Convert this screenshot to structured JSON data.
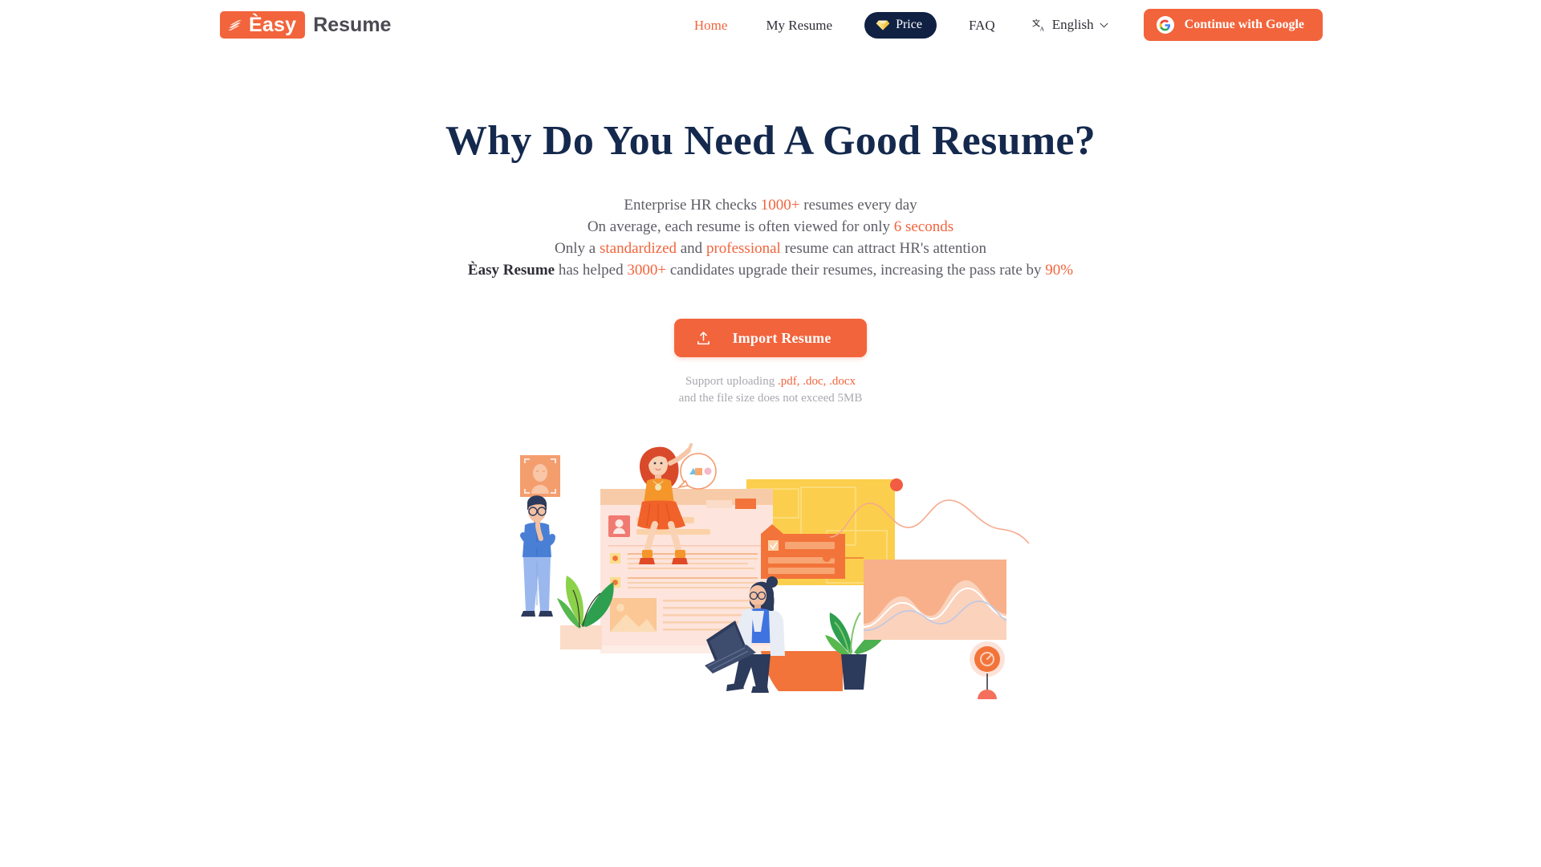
{
  "brand": {
    "mark_icon": "stacked-lines-logo-icon",
    "easy": "Èasy",
    "resume": "Resume"
  },
  "nav": {
    "items": [
      {
        "label": "Home",
        "active": true
      },
      {
        "label": "My Resume",
        "active": false
      }
    ],
    "price": {
      "label": "Price",
      "icon": "gem-icon",
      "bg": "#102144"
    },
    "faq": {
      "label": "FAQ"
    },
    "language": {
      "label": "English",
      "icon": "translate-icon",
      "chevron": "chevron-down-icon"
    },
    "google": {
      "label": "Continue with Google",
      "icon": "google-g-icon",
      "bg": "#F2643C"
    }
  },
  "hero": {
    "title": "Why Do You Need A Good Resume?",
    "line1": {
      "a": "Enterprise HR checks ",
      "hl": "1000+",
      "b": " resumes every day"
    },
    "line2": {
      "a": "On average, each resume is often viewed for only ",
      "hl": "6 seconds",
      "b": ""
    },
    "line3": {
      "a": "Only a ",
      "hl1": "standardized",
      "b": " and ",
      "hl2": "professional",
      "c": " resume can attract HR's attention"
    },
    "line4": {
      "brand": "Èasy Resume",
      "a": " has helped ",
      "hl1": "3000+",
      "b": " candidates upgrade their resumes, increasing the pass rate by ",
      "hl2": "90%"
    }
  },
  "import": {
    "label": "Import Resume",
    "icon": "upload-icon",
    "bg": "#F2643C",
    "support_a": "Support uploading ",
    "support_formats": ".pdf, .doc, .docx",
    "support_b": "and the file size does not exceed 5MB"
  },
  "illustration": {
    "name": "resume-building-illustration",
    "colors": {
      "orange": "#F2643C",
      "light_orange": "#FBC08A",
      "yellow": "#FBCF4D",
      "pink": "#FCE9E4",
      "navy": "#2C3A5B",
      "blue": "#7FA3E8",
      "green": "#4CAF50"
    }
  }
}
